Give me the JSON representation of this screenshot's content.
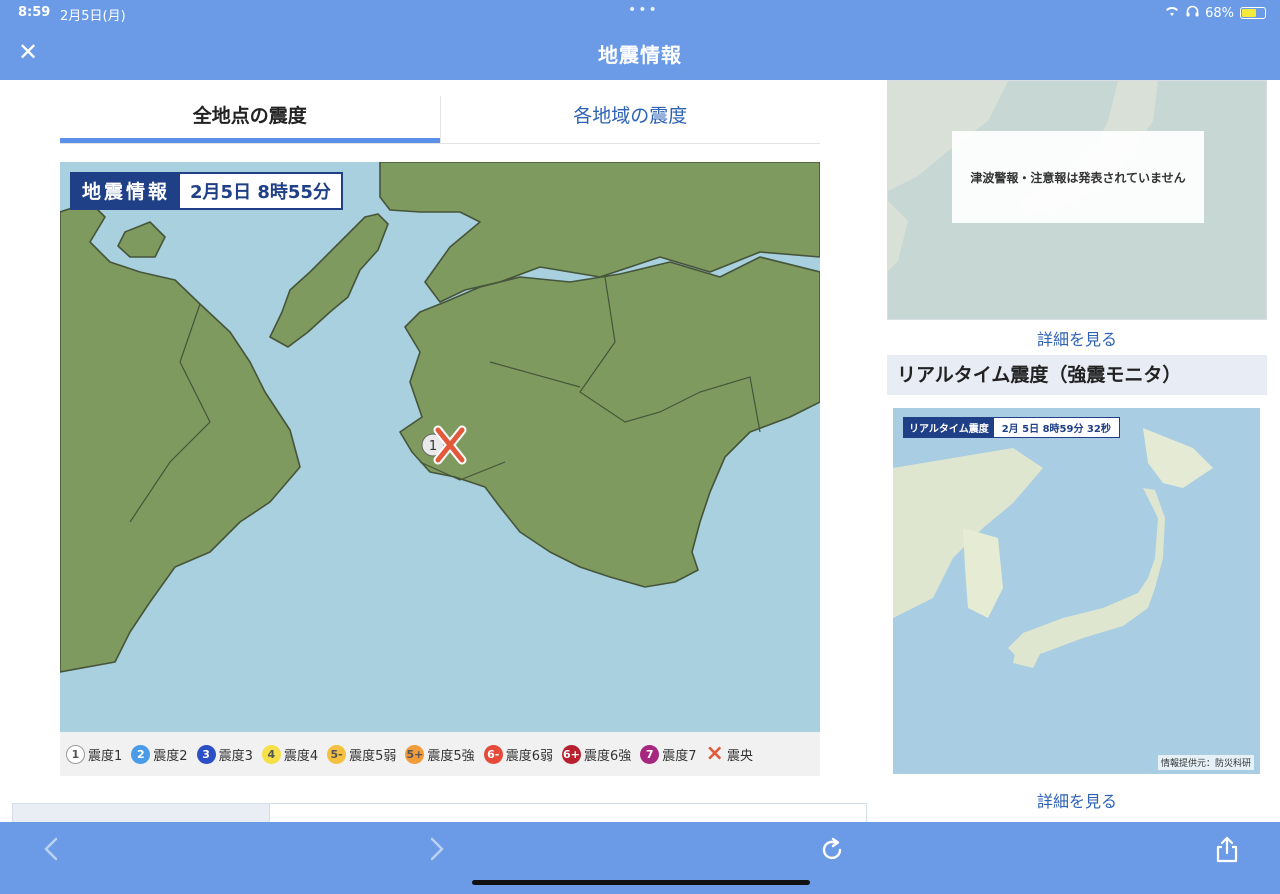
{
  "status_bar": {
    "time": "8:59",
    "date": "2月5日(月)",
    "battery": "68%",
    "battery_level": 0.68
  },
  "nav": {
    "title": "地震情報",
    "close_icon": "close-icon"
  },
  "tabs": [
    {
      "label": "全地点の震度",
      "active": true
    },
    {
      "label": "各地域の震度",
      "active": false
    }
  ],
  "quake_map": {
    "badge_label": "地震情報",
    "badge_value": "2月5日  8時55分",
    "observed_intensity": "1"
  },
  "legend": [
    {
      "symbol": "1",
      "label": "震度1",
      "color": "#ffffff",
      "text_color": "#555555"
    },
    {
      "symbol": "2",
      "label": "震度2",
      "color": "#4a9be8",
      "text_color": "#ffffff"
    },
    {
      "symbol": "3",
      "label": "震度3",
      "color": "#2b4fc4",
      "text_color": "#ffffff"
    },
    {
      "symbol": "4",
      "label": "震度4",
      "color": "#f5e04a",
      "text_color": "#555555"
    },
    {
      "symbol": "5-",
      "label": "震度5弱",
      "color": "#f3c040",
      "text_color": "#555555"
    },
    {
      "symbol": "5+",
      "label": "震度5強",
      "color": "#f29b3a",
      "text_color": "#555555"
    },
    {
      "symbol": "6-",
      "label": "震度6弱",
      "color": "#e54a3a",
      "text_color": "#ffffff"
    },
    {
      "symbol": "6+",
      "label": "震度6強",
      "color": "#b8202e",
      "text_color": "#ffffff"
    },
    {
      "symbol": "7",
      "label": "震度7",
      "color": "#a6277f",
      "text_color": "#ffffff"
    },
    {
      "symbol": "×",
      "label": "震央",
      "color": "#e2593b",
      "text_color": "#e2593b"
    }
  ],
  "side": {
    "tsunami_message": "津波警報・注意報は発表されていません",
    "detail_link_1": "詳細を見る",
    "section_title": "リアルタイム震度（強震モニタ）",
    "rt_badge_label": "リアルタイム震度",
    "rt_badge_value": "2月  5日   8時59分 32秒",
    "credit": "情報提供元：防災科研",
    "detail_link_2": "詳細を見る"
  },
  "colors": {
    "accent": "#6b9be6",
    "land": "#7f9a5f",
    "sea": "#a8d0df",
    "link": "#2d62b6"
  },
  "toolbar": {
    "back_icon": "chevron-left-icon",
    "forward_icon": "chevron-right-icon",
    "reload_icon": "reload-icon",
    "share_icon": "share-icon"
  }
}
